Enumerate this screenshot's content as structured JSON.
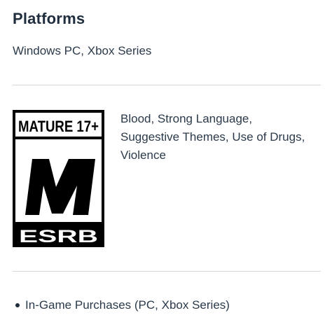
{
  "platforms": {
    "title": "Platforms",
    "value": "Windows PC, Xbox Series"
  },
  "rating": {
    "badge_top_text": "MATURE 17+",
    "badge_letter": "M",
    "badge_bottom_text": "ESRB",
    "descriptor_lines": [
      "Blood, Strong Language,",
      "Suggestive Themes, Use of Drugs,",
      "Violence"
    ]
  },
  "interactive_elements": [
    "In-Game Purchases (PC, Xbox Series)"
  ]
}
